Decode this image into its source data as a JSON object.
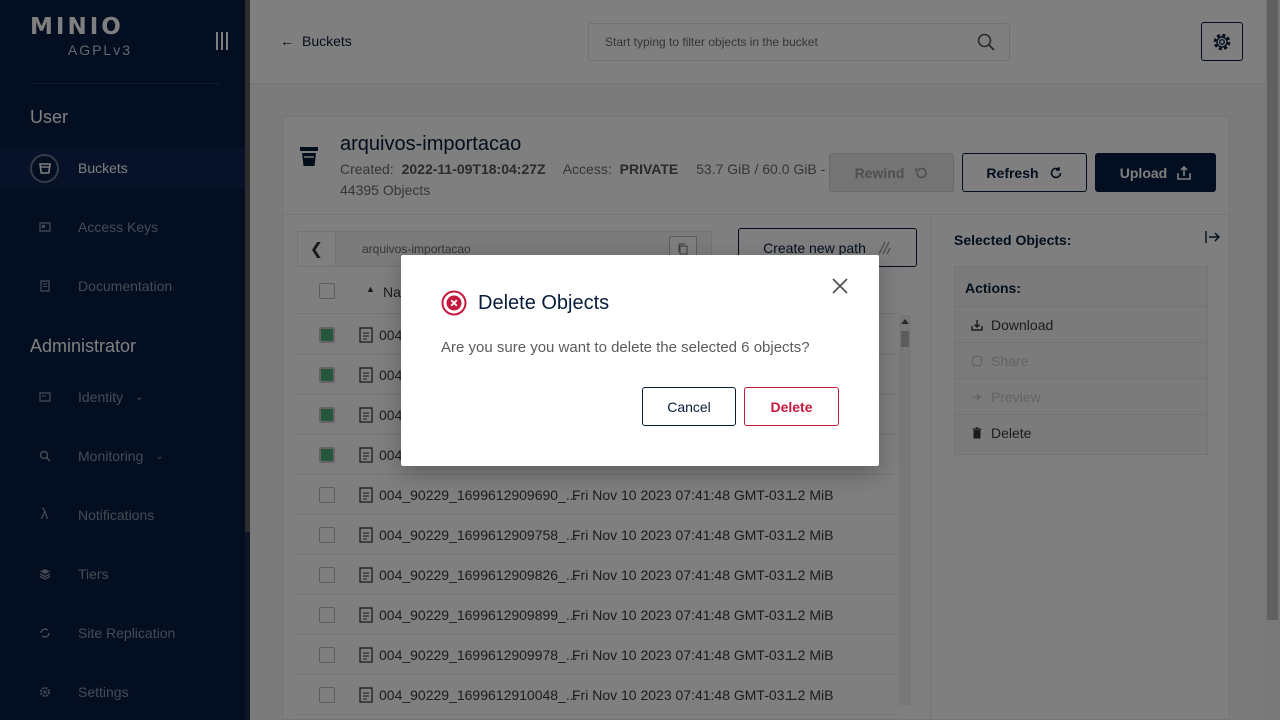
{
  "sidebar": {
    "logo": "MINIO",
    "license": "AGPLv3",
    "user_section": "User",
    "admin_section": "Administrator",
    "user_items": [
      {
        "label": "Buckets",
        "icon": "bucket-icon",
        "active": true
      },
      {
        "label": "Access Keys",
        "icon": "key-icon"
      },
      {
        "label": "Documentation",
        "icon": "document-icon"
      }
    ],
    "admin_items": [
      {
        "label": "Identity",
        "icon": "identity-icon",
        "expandable": true
      },
      {
        "label": "Monitoring",
        "icon": "monitoring-icon",
        "expandable": true
      },
      {
        "label": "Notifications",
        "icon": "lambda-icon"
      },
      {
        "label": "Tiers",
        "icon": "tiers-icon"
      },
      {
        "label": "Site Replication",
        "icon": "replication-icon"
      },
      {
        "label": "Settings",
        "icon": "settings-icon"
      }
    ]
  },
  "header": {
    "back_label": "Buckets",
    "search_placeholder": "Start typing to filter objects in the bucket"
  },
  "bucket": {
    "name": "arquivos-importacao",
    "created_label": "Created:",
    "created_value": "2022-11-09T18:04:27Z",
    "access_label": "Access:",
    "access_value": "PRIVATE",
    "usage": "53.7 GiB / 60.0 GiB -",
    "objects": "44395 Objects",
    "rewind_label": "Rewind",
    "refresh_label": "Refresh",
    "upload_label": "Upload"
  },
  "browser": {
    "path": "arquivos-importacao",
    "create_path_label": "Create new path",
    "name_header": "Na",
    "rows": [
      {
        "name": "004",
        "date": "",
        "size": "",
        "checked": true
      },
      {
        "name": "004",
        "date": "",
        "size": "",
        "checked": true
      },
      {
        "name": "004",
        "date": "",
        "size": "",
        "checked": true
      },
      {
        "name": "004",
        "date": "",
        "size": "",
        "checked": true
      },
      {
        "name": "004_90229_1699612909690_...",
        "date": "Fri Nov 10 2023 07:41:48 GMT-03...",
        "size": "1.2 MiB",
        "checked": false
      },
      {
        "name": "004_90229_1699612909758_...",
        "date": "Fri Nov 10 2023 07:41:48 GMT-03...",
        "size": "1.2 MiB",
        "checked": false
      },
      {
        "name": "004_90229_1699612909826_...",
        "date": "Fri Nov 10 2023 07:41:48 GMT-03...",
        "size": "1.2 MiB",
        "checked": false
      },
      {
        "name": "004_90229_1699612909899_...",
        "date": "Fri Nov 10 2023 07:41:48 GMT-03...",
        "size": "1.2 MiB",
        "checked": false
      },
      {
        "name": "004_90229_1699612909978_...",
        "date": "Fri Nov 10 2023 07:41:48 GMT-03...",
        "size": "1.2 MiB",
        "checked": false
      },
      {
        "name": "004_90229_1699612910048_...",
        "date": "Fri Nov 10 2023 07:41:48 GMT-03...",
        "size": "1.2 MiB",
        "checked": false
      }
    ]
  },
  "selected_panel": {
    "title": "Selected Objects:",
    "actions_title": "Actions:",
    "actions": [
      {
        "label": "Download",
        "icon": "download-icon",
        "enabled": true
      },
      {
        "label": "Share",
        "icon": "share-icon",
        "enabled": false
      },
      {
        "label": "Preview",
        "icon": "preview-icon",
        "enabled": false
      },
      {
        "label": "Delete",
        "icon": "trash-icon",
        "enabled": true
      }
    ]
  },
  "modal": {
    "title": "Delete Objects",
    "message": "Are you sure you want to delete the selected 6 objects?",
    "cancel_label": "Cancel",
    "delete_label": "Delete",
    "accent_color": "#c51a3e"
  },
  "colors": {
    "sidebar_bg": "#081c42",
    "primary": "#071d3a",
    "danger": "#c51a3e",
    "checked": "#4caf7a"
  }
}
